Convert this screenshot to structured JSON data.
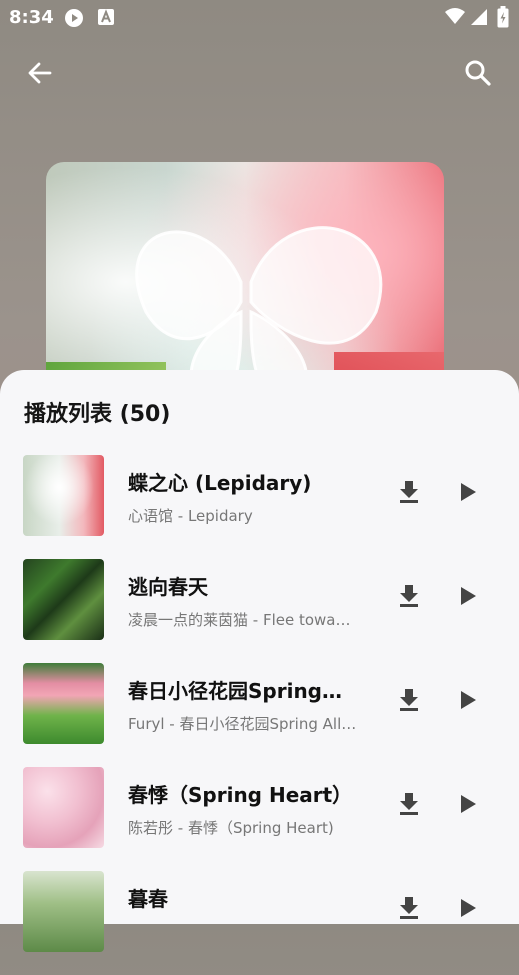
{
  "status": {
    "time": "8:34"
  },
  "header": {
    "back_icon": "back-arrow-icon",
    "search_icon": "search-icon"
  },
  "playlist": {
    "title": "播放列表 (50)",
    "songs": [
      {
        "title": "蝶之心 (Lepidary)",
        "subtitle": "心语馆 - Lepidary"
      },
      {
        "title": "逃向春天",
        "subtitle": "凌晨一点的莱茵猫 - Flee towa…"
      },
      {
        "title": "春日小径花园Spring…",
        "subtitle": "Furyl - 春日小径花园Spring All…"
      },
      {
        "title": "春悸（Spring Heart）",
        "subtitle": "陈若彤 - 春悸（Spring Heart)"
      },
      {
        "title": "暮春",
        "subtitle": ""
      }
    ]
  },
  "colors": {
    "sheet_bg": "#f7f7f9",
    "text_primary": "#111111",
    "text_secondary": "#777777"
  }
}
